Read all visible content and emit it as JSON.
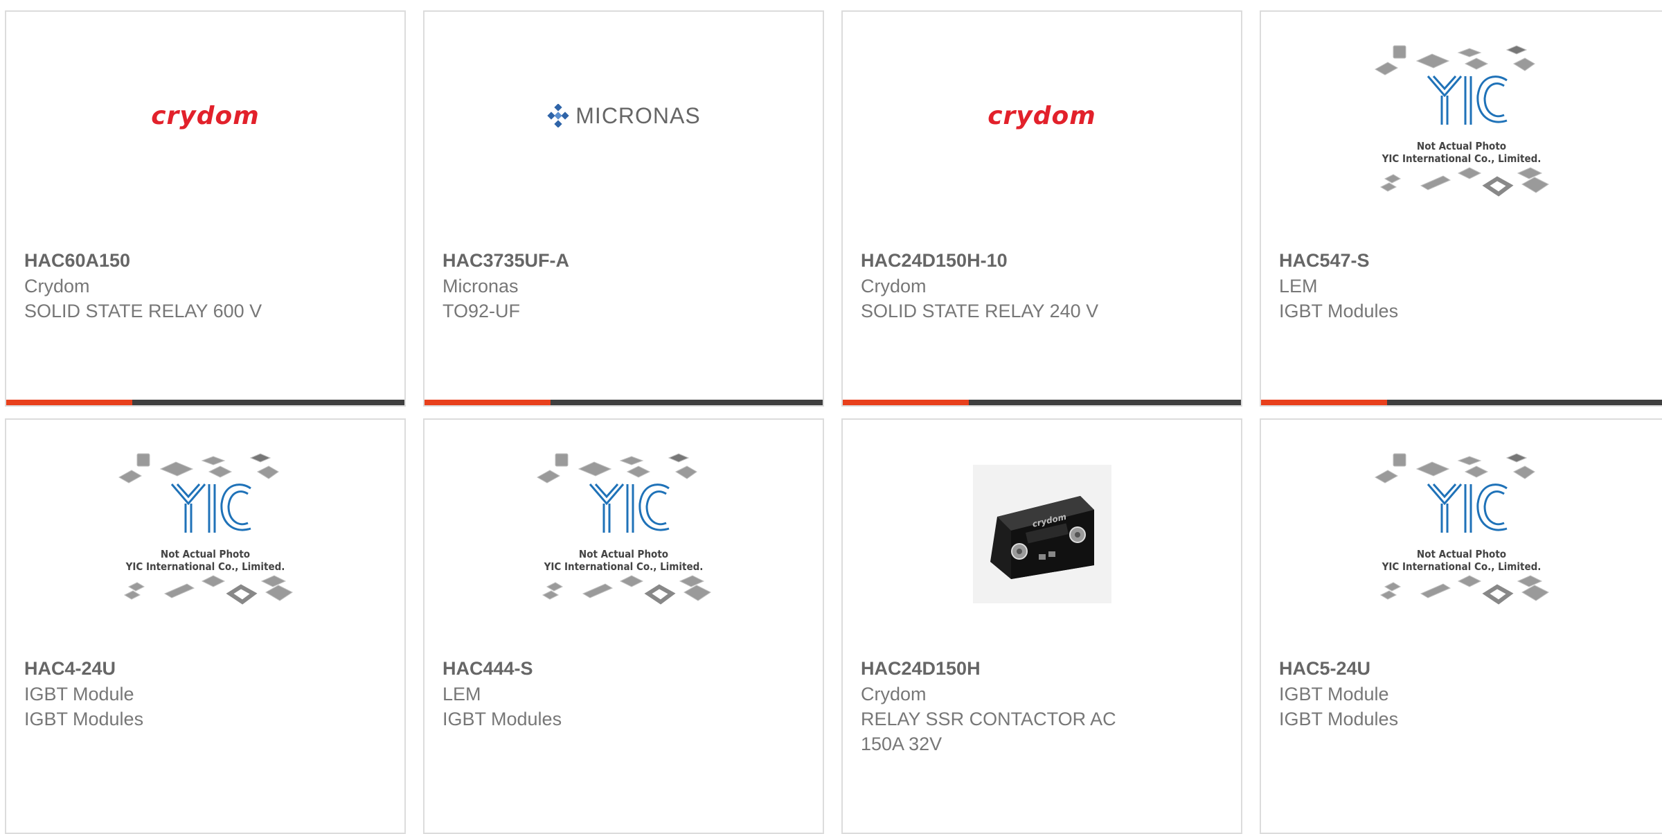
{
  "products": [
    {
      "part_number": "HAC60A150",
      "manufacturer": "Crydom",
      "description": "SOLID STATE RELAY 600 V",
      "image": "crydom-logo",
      "logo_text": "crydom"
    },
    {
      "part_number": "HAC3735UF-A",
      "manufacturer": "Micronas",
      "description": "TO92-UF",
      "image": "micronas-logo",
      "logo_text": "MICRONAS"
    },
    {
      "part_number": "HAC24D150H-10",
      "manufacturer": "Crydom",
      "description": "SOLID STATE RELAY 240 V",
      "image": "crydom-logo",
      "logo_text": "crydom"
    },
    {
      "part_number": "HAC547-S",
      "manufacturer": "LEM",
      "description": "IGBT Modules",
      "image": "not-actual-photo",
      "placeholder_line1": "Not Actual Photo",
      "placeholder_line2": "YIC International Co., Limited."
    },
    {
      "part_number": "HAC4-24U",
      "manufacturer": "IGBT Module",
      "description": "IGBT Modules",
      "image": "not-actual-photo",
      "placeholder_line1": "Not Actual Photo",
      "placeholder_line2": "YIC International Co., Limited."
    },
    {
      "part_number": "HAC444-S",
      "manufacturer": "LEM",
      "description": "IGBT Modules",
      "image": "not-actual-photo",
      "placeholder_line1": "Not Actual Photo",
      "placeholder_line2": "YIC International Co., Limited."
    },
    {
      "part_number": "HAC24D150H",
      "manufacturer": "Crydom",
      "description": "RELAY SSR CONTACTOR AC 150A 32V",
      "image": "relay-photo",
      "logo_text": "crydom"
    },
    {
      "part_number": "HAC5-24U",
      "manufacturer": "IGBT Module",
      "description": "IGBT Modules",
      "image": "not-actual-photo",
      "placeholder_line1": "Not Actual Photo",
      "placeholder_line2": "YIC International Co., Limited."
    }
  ],
  "colors": {
    "accent": "#e8401c",
    "bar": "#3f3f3f",
    "crydom_red": "#e2212b",
    "yic_blue": "#1f72b8",
    "micronas_blue": "#2f64a8"
  }
}
